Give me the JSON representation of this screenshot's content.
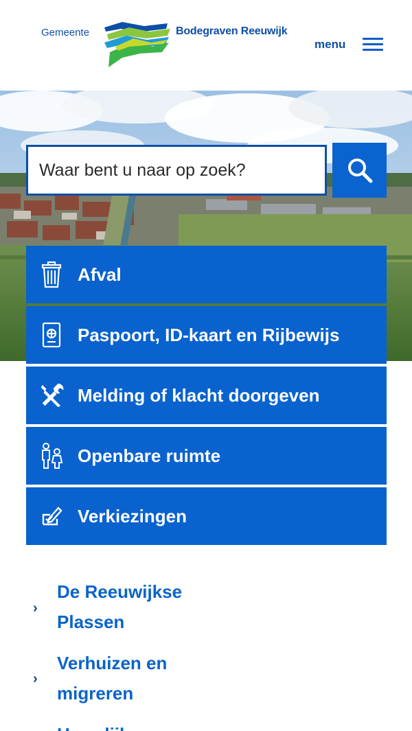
{
  "header": {
    "logo_prefix": "Gemeente",
    "logo_name": "Bodegraven Reeuwijk",
    "menu_label": "menu",
    "menu_icon": "hamburger-icon"
  },
  "search": {
    "placeholder": "Waar bent u naar op zoek?",
    "value": "",
    "button_icon": "search-icon"
  },
  "tiles": [
    {
      "label": "Afval",
      "icon": "trash-bin-icon"
    },
    {
      "label": "Paspoort, ID-kaart en Rijbewijs",
      "icon": "passport-icon"
    },
    {
      "label": "Melding of klacht doorgeven",
      "icon": "tools-icon"
    },
    {
      "label": "Openbare ruimte",
      "icon": "people-icon"
    },
    {
      "label": "Verkiezingen",
      "icon": "ballot-pencil-icon"
    }
  ],
  "links": [
    {
      "label": "De Reeuwijkse Plassen",
      "icon": "chevron-right-icon"
    },
    {
      "label": "Verhuizen en migreren",
      "icon": "chevron-right-icon"
    },
    {
      "label": "Huwelijk",
      "icon": "chevron-right-icon"
    }
  ],
  "colors": {
    "brand_blue": "#0962ce",
    "link_blue": "#0a64c8",
    "logo_blue": "#0d4fa8"
  }
}
